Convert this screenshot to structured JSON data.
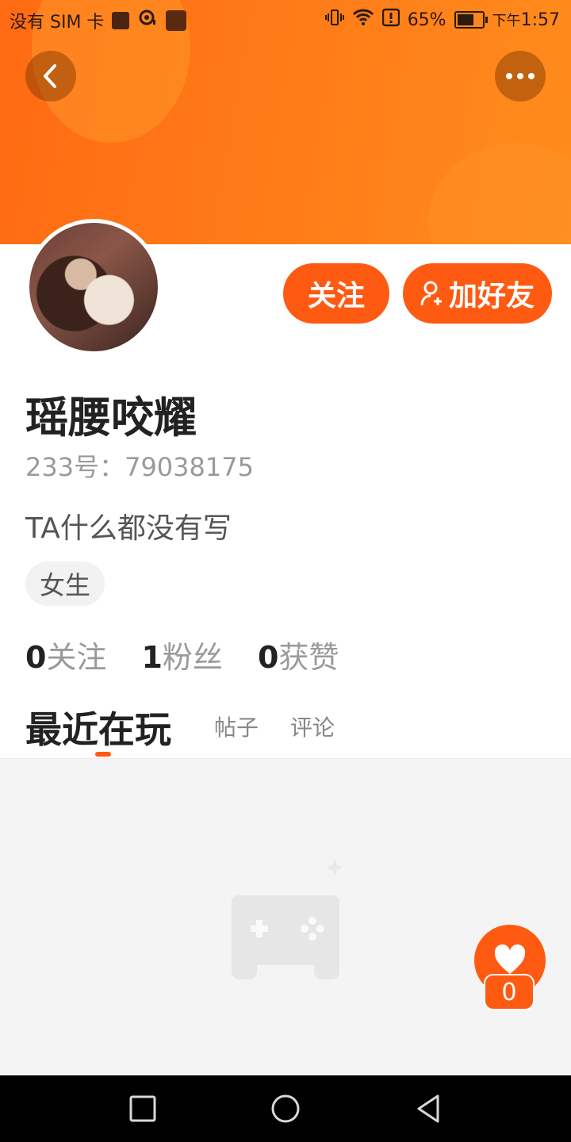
{
  "status_bar": {
    "carrier": "没有 SIM 卡",
    "battery": "65%",
    "battery_level": 0.65,
    "time_prefix": "下午",
    "time": "1:57"
  },
  "colors": {
    "accent": "#ff5a12",
    "banner": "#ff7a18"
  },
  "profile": {
    "username": "瑶腰咬耀",
    "id_text": "233号：79038175",
    "bio": "TA什么都没有写",
    "tag": "女生",
    "follow_label": "关注",
    "add_friend_label": "加好友"
  },
  "stats": [
    {
      "num": "0",
      "label": "关注"
    },
    {
      "num": "1",
      "label": "粉丝"
    },
    {
      "num": "0",
      "label": "获赞"
    }
  ],
  "tabs": {
    "active": "最近在玩",
    "posts": "帖子",
    "comments": "评论"
  },
  "like": {
    "count": "0"
  },
  "icons": [
    "back-icon",
    "more-icon",
    "add-user-icon",
    "gamepad-icon",
    "heart-icon",
    "recent-apps-icon",
    "home-icon",
    "nav-back-icon"
  ]
}
